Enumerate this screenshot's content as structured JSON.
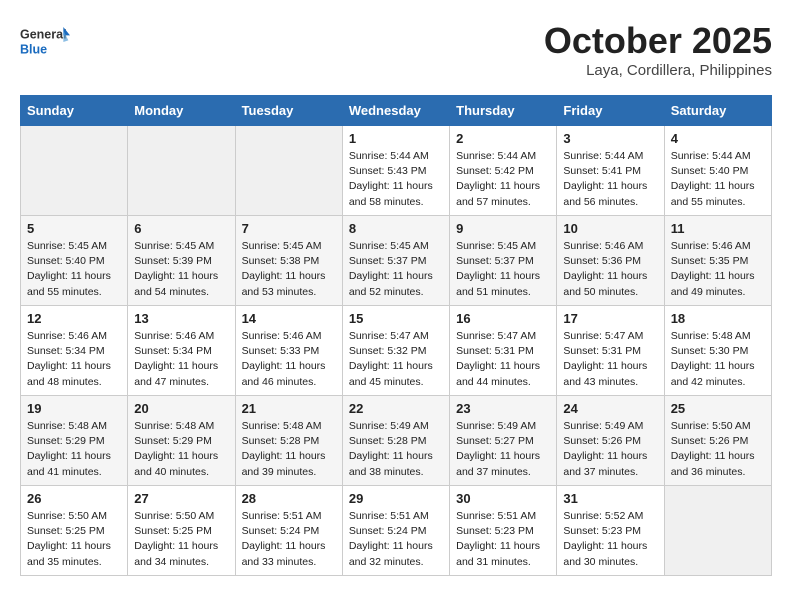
{
  "header": {
    "logo_general": "General",
    "logo_blue": "Blue",
    "month": "October 2025",
    "location": "Laya, Cordillera, Philippines"
  },
  "days_of_week": [
    "Sunday",
    "Monday",
    "Tuesday",
    "Wednesday",
    "Thursday",
    "Friday",
    "Saturday"
  ],
  "weeks": [
    [
      {
        "day": "",
        "sunrise": "",
        "sunset": "",
        "daylight": ""
      },
      {
        "day": "",
        "sunrise": "",
        "sunset": "",
        "daylight": ""
      },
      {
        "day": "",
        "sunrise": "",
        "sunset": "",
        "daylight": ""
      },
      {
        "day": "1",
        "sunrise": "Sunrise: 5:44 AM",
        "sunset": "Sunset: 5:43 PM",
        "daylight": "Daylight: 11 hours and 58 minutes."
      },
      {
        "day": "2",
        "sunrise": "Sunrise: 5:44 AM",
        "sunset": "Sunset: 5:42 PM",
        "daylight": "Daylight: 11 hours and 57 minutes."
      },
      {
        "day": "3",
        "sunrise": "Sunrise: 5:44 AM",
        "sunset": "Sunset: 5:41 PM",
        "daylight": "Daylight: 11 hours and 56 minutes."
      },
      {
        "day": "4",
        "sunrise": "Sunrise: 5:44 AM",
        "sunset": "Sunset: 5:40 PM",
        "daylight": "Daylight: 11 hours and 55 minutes."
      }
    ],
    [
      {
        "day": "5",
        "sunrise": "Sunrise: 5:45 AM",
        "sunset": "Sunset: 5:40 PM",
        "daylight": "Daylight: 11 hours and 55 minutes."
      },
      {
        "day": "6",
        "sunrise": "Sunrise: 5:45 AM",
        "sunset": "Sunset: 5:39 PM",
        "daylight": "Daylight: 11 hours and 54 minutes."
      },
      {
        "day": "7",
        "sunrise": "Sunrise: 5:45 AM",
        "sunset": "Sunset: 5:38 PM",
        "daylight": "Daylight: 11 hours and 53 minutes."
      },
      {
        "day": "8",
        "sunrise": "Sunrise: 5:45 AM",
        "sunset": "Sunset: 5:37 PM",
        "daylight": "Daylight: 11 hours and 52 minutes."
      },
      {
        "day": "9",
        "sunrise": "Sunrise: 5:45 AM",
        "sunset": "Sunset: 5:37 PM",
        "daylight": "Daylight: 11 hours and 51 minutes."
      },
      {
        "day": "10",
        "sunrise": "Sunrise: 5:46 AM",
        "sunset": "Sunset: 5:36 PM",
        "daylight": "Daylight: 11 hours and 50 minutes."
      },
      {
        "day": "11",
        "sunrise": "Sunrise: 5:46 AM",
        "sunset": "Sunset: 5:35 PM",
        "daylight": "Daylight: 11 hours and 49 minutes."
      }
    ],
    [
      {
        "day": "12",
        "sunrise": "Sunrise: 5:46 AM",
        "sunset": "Sunset: 5:34 PM",
        "daylight": "Daylight: 11 hours and 48 minutes."
      },
      {
        "day": "13",
        "sunrise": "Sunrise: 5:46 AM",
        "sunset": "Sunset: 5:34 PM",
        "daylight": "Daylight: 11 hours and 47 minutes."
      },
      {
        "day": "14",
        "sunrise": "Sunrise: 5:46 AM",
        "sunset": "Sunset: 5:33 PM",
        "daylight": "Daylight: 11 hours and 46 minutes."
      },
      {
        "day": "15",
        "sunrise": "Sunrise: 5:47 AM",
        "sunset": "Sunset: 5:32 PM",
        "daylight": "Daylight: 11 hours and 45 minutes."
      },
      {
        "day": "16",
        "sunrise": "Sunrise: 5:47 AM",
        "sunset": "Sunset: 5:31 PM",
        "daylight": "Daylight: 11 hours and 44 minutes."
      },
      {
        "day": "17",
        "sunrise": "Sunrise: 5:47 AM",
        "sunset": "Sunset: 5:31 PM",
        "daylight": "Daylight: 11 hours and 43 minutes."
      },
      {
        "day": "18",
        "sunrise": "Sunrise: 5:48 AM",
        "sunset": "Sunset: 5:30 PM",
        "daylight": "Daylight: 11 hours and 42 minutes."
      }
    ],
    [
      {
        "day": "19",
        "sunrise": "Sunrise: 5:48 AM",
        "sunset": "Sunset: 5:29 PM",
        "daylight": "Daylight: 11 hours and 41 minutes."
      },
      {
        "day": "20",
        "sunrise": "Sunrise: 5:48 AM",
        "sunset": "Sunset: 5:29 PM",
        "daylight": "Daylight: 11 hours and 40 minutes."
      },
      {
        "day": "21",
        "sunrise": "Sunrise: 5:48 AM",
        "sunset": "Sunset: 5:28 PM",
        "daylight": "Daylight: 11 hours and 39 minutes."
      },
      {
        "day": "22",
        "sunrise": "Sunrise: 5:49 AM",
        "sunset": "Sunset: 5:28 PM",
        "daylight": "Daylight: 11 hours and 38 minutes."
      },
      {
        "day": "23",
        "sunrise": "Sunrise: 5:49 AM",
        "sunset": "Sunset: 5:27 PM",
        "daylight": "Daylight: 11 hours and 37 minutes."
      },
      {
        "day": "24",
        "sunrise": "Sunrise: 5:49 AM",
        "sunset": "Sunset: 5:26 PM",
        "daylight": "Daylight: 11 hours and 37 minutes."
      },
      {
        "day": "25",
        "sunrise": "Sunrise: 5:50 AM",
        "sunset": "Sunset: 5:26 PM",
        "daylight": "Daylight: 11 hours and 36 minutes."
      }
    ],
    [
      {
        "day": "26",
        "sunrise": "Sunrise: 5:50 AM",
        "sunset": "Sunset: 5:25 PM",
        "daylight": "Daylight: 11 hours and 35 minutes."
      },
      {
        "day": "27",
        "sunrise": "Sunrise: 5:50 AM",
        "sunset": "Sunset: 5:25 PM",
        "daylight": "Daylight: 11 hours and 34 minutes."
      },
      {
        "day": "28",
        "sunrise": "Sunrise: 5:51 AM",
        "sunset": "Sunset: 5:24 PM",
        "daylight": "Daylight: 11 hours and 33 minutes."
      },
      {
        "day": "29",
        "sunrise": "Sunrise: 5:51 AM",
        "sunset": "Sunset: 5:24 PM",
        "daylight": "Daylight: 11 hours and 32 minutes."
      },
      {
        "day": "30",
        "sunrise": "Sunrise: 5:51 AM",
        "sunset": "Sunset: 5:23 PM",
        "daylight": "Daylight: 11 hours and 31 minutes."
      },
      {
        "day": "31",
        "sunrise": "Sunrise: 5:52 AM",
        "sunset": "Sunset: 5:23 PM",
        "daylight": "Daylight: 11 hours and 30 minutes."
      },
      {
        "day": "",
        "sunrise": "",
        "sunset": "",
        "daylight": ""
      }
    ]
  ]
}
